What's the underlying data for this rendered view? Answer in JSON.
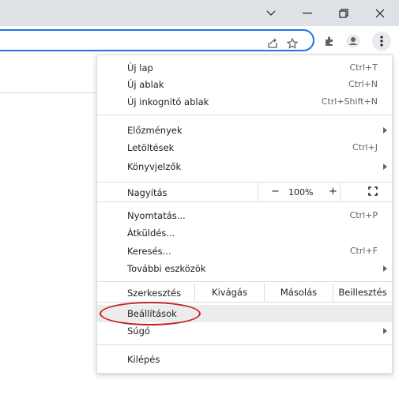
{
  "window": {
    "buttons": [
      "chevron-down-icon",
      "minimize-icon",
      "restore-icon",
      "close-icon"
    ]
  },
  "toolbar": {
    "omnibox_icons": [
      "share-icon",
      "star-icon"
    ],
    "icons": [
      "extensions-icon",
      "profile-icon",
      "kebab-menu-icon"
    ]
  },
  "menu": {
    "new_tab": {
      "label": "Új lap",
      "shortcut": "Ctrl+T"
    },
    "new_window": {
      "label": "Új ablak",
      "shortcut": "Ctrl+N"
    },
    "incognito": {
      "label": "Új inkognitó ablak",
      "shortcut": "Ctrl+Shift+N"
    },
    "history": {
      "label": "Előzmények"
    },
    "downloads": {
      "label": "Letöltések",
      "shortcut": "Ctrl+J"
    },
    "bookmarks": {
      "label": "Könyvjelzők"
    },
    "zoom": {
      "label": "Nagyítás",
      "minus": "−",
      "value": "100%",
      "plus": "+"
    },
    "print": {
      "label": "Nyomtatás...",
      "shortcut": "Ctrl+P"
    },
    "cast": {
      "label": "Átküldés..."
    },
    "find": {
      "label": "Keresés...",
      "shortcut": "Ctrl+F"
    },
    "more_tools": {
      "label": "További eszközök"
    },
    "edit": {
      "label": "Szerkesztés",
      "cut": "Kivágás",
      "copy": "Másolás",
      "paste": "Beillesztés"
    },
    "settings": {
      "label": "Beállítások"
    },
    "help": {
      "label": "Súgó"
    },
    "exit": {
      "label": "Kilépés"
    }
  },
  "colors": {
    "accent": "#1a73e8",
    "highlight": "#ececec",
    "annotation": "#c42323",
    "titlebar": "#dee1e6"
  }
}
